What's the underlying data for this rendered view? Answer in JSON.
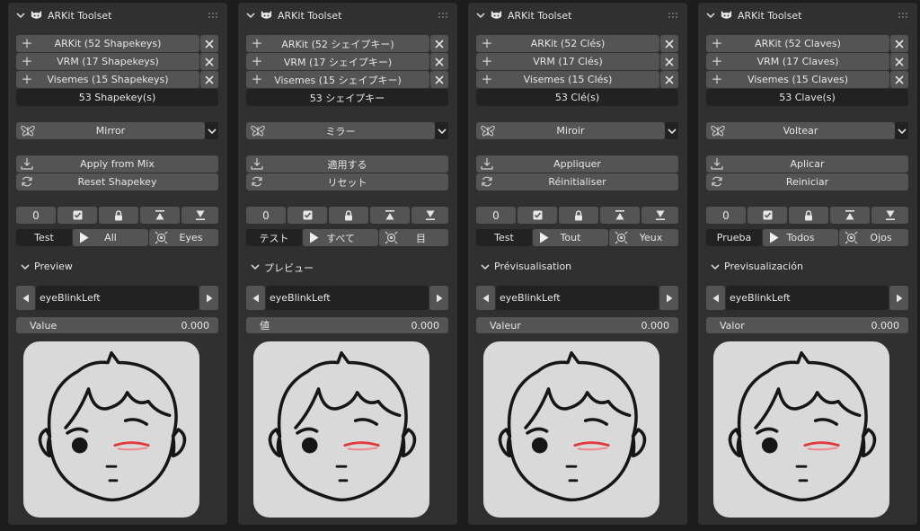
{
  "app": {
    "title": "ARKit Toolset",
    "colors": {
      "panel": "#303030",
      "button": "#545454",
      "dark": "#222222",
      "accent_blink": "#e23a3a"
    },
    "icons": {
      "expand": "chevron-down-icon",
      "logo": "cat-logo-icon",
      "drag": "grip-icon",
      "add": "plus-icon",
      "remove": "x-icon",
      "mirror": "butterfly-icon",
      "apply": "download-icon",
      "reset": "refresh-icon",
      "zero": "zero-icon",
      "check": "checkbox-icon",
      "lock": "lock-icon",
      "top": "move-top-icon",
      "bottom": "move-bottom-icon",
      "play": "play-icon",
      "eye": "eye-target-icon",
      "prev": "triangle-left-icon",
      "next": "triangle-right-icon"
    }
  },
  "panels": [
    {
      "title": "ARKit Toolset",
      "shapekey_sets": [
        "ARKit (52 Shapekeys)",
        "VRM (17 Shapekeys)",
        "Visemes (15 Shapekeys)"
      ],
      "count": "53  Shapekey(s)",
      "mirror": "Mirror",
      "apply": "Apply from Mix",
      "reset": "Reset Shapekey",
      "zero": "0",
      "test": "Test",
      "all": "All",
      "eyes": "Eyes",
      "preview": "Preview",
      "shapekey": "eyeBlinkLeft",
      "value_label": "Value",
      "value": "0.000"
    },
    {
      "title": "ARKit Toolset",
      "shapekey_sets": [
        "ARKit (52 シェイプキー)",
        "VRM (17 シェイプキー)",
        "Visemes (15 シェイプキー)"
      ],
      "count": "53  シェイプキー",
      "mirror": "ミラー",
      "apply": "適用する",
      "reset": "リセット",
      "zero": "0",
      "test": "テスト",
      "all": "すべて",
      "eyes": "目",
      "preview": "プレビュー",
      "shapekey": "eyeBlinkLeft",
      "value_label": "値",
      "value": "0.000"
    },
    {
      "title": "ARKit Toolset",
      "shapekey_sets": [
        "ARKit (52 Clés)",
        "VRM (17 Clés)",
        "Visemes (15 Clés)"
      ],
      "count": "53  Clé(s)",
      "mirror": "Miroir",
      "apply": "Appliquer",
      "reset": "Réinitialiser",
      "zero": "0",
      "test": "Test",
      "all": "Tout",
      "eyes": "Yeux",
      "preview": "Prévisualisation",
      "shapekey": "eyeBlinkLeft",
      "value_label": "Valeur",
      "value": "0.000"
    },
    {
      "title": "ARKit Toolset",
      "shapekey_sets": [
        "ARKit (52 Claves)",
        "VRM (17 Claves)",
        "Visemes (15 Claves)"
      ],
      "count": "53  Clave(s)",
      "mirror": "Voltear",
      "apply": "Aplicar",
      "reset": "Reiniciar",
      "zero": "0",
      "test": "Prueba",
      "all": "Todos",
      "eyes": "Ojos",
      "preview": "Previsualización",
      "shapekey": "eyeBlinkLeft",
      "value_label": "Valor",
      "value": "0.000"
    }
  ]
}
